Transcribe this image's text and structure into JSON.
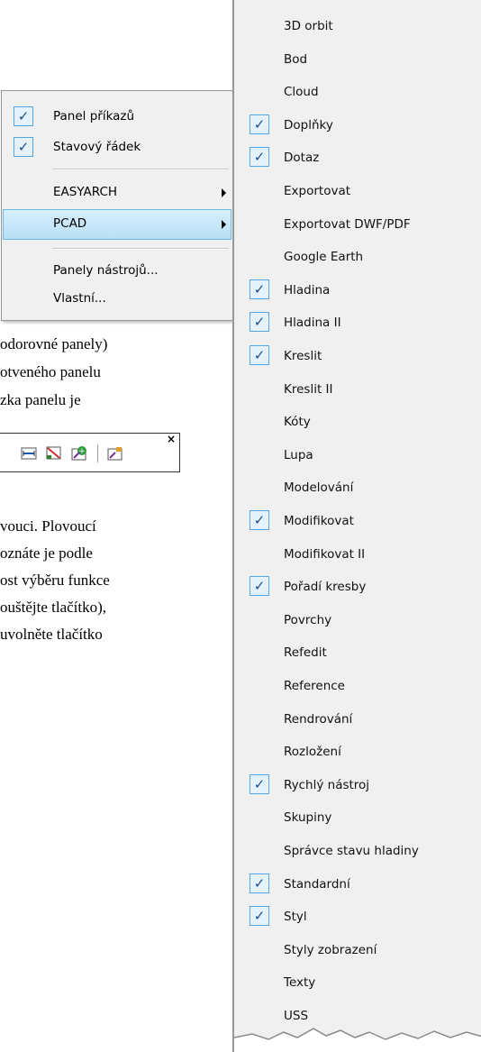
{
  "document": {
    "lines": [
      "odorovné panely)",
      "otveného panelu",
      "zka panelu je",
      "vouci. Plovoucí",
      "oznáte je podle",
      "ost výběru funkce",
      "ouštějte tlačítko),",
      "uvolněte tlačítko"
    ]
  },
  "context_menu": {
    "items": [
      {
        "label": "Panel příkazů",
        "checked": true
      },
      {
        "label": "Stavový řádek",
        "checked": true
      },
      {
        "label": "EASYARCH",
        "submenu": true
      },
      {
        "label": "PCAD",
        "submenu": true,
        "highlighted": true
      },
      {
        "label": "Panely nástrojů..."
      },
      {
        "label": "Vlastní..."
      }
    ]
  },
  "toolbar_menu": {
    "items": [
      {
        "label": "3D orbit",
        "checked": false
      },
      {
        "label": "Bod",
        "checked": false
      },
      {
        "label": "Cloud",
        "checked": false
      },
      {
        "label": "Doplňky",
        "checked": true
      },
      {
        "label": "Dotaz",
        "checked": true
      },
      {
        "label": "Exportovat",
        "checked": false
      },
      {
        "label": "Exportovat DWF/PDF",
        "checked": false
      },
      {
        "label": "Google Earth",
        "checked": false
      },
      {
        "label": "Hladina",
        "checked": true
      },
      {
        "label": "Hladina II",
        "checked": true
      },
      {
        "label": "Kreslit",
        "checked": true
      },
      {
        "label": "Kreslit II",
        "checked": false
      },
      {
        "label": "Kóty",
        "checked": false
      },
      {
        "label": "Lupa",
        "checked": false
      },
      {
        "label": "Modelování",
        "checked": false
      },
      {
        "label": "Modifikovat",
        "checked": true
      },
      {
        "label": "Modifikovat II",
        "checked": false
      },
      {
        "label": "Pořadí kresby",
        "checked": true
      },
      {
        "label": "Povrchy",
        "checked": false
      },
      {
        "label": "Refedit",
        "checked": false
      },
      {
        "label": "Reference",
        "checked": false
      },
      {
        "label": "Rendrování",
        "checked": false
      },
      {
        "label": "Rozložení",
        "checked": false
      },
      {
        "label": "Rychlý nástroj",
        "checked": true
      },
      {
        "label": "Skupiny",
        "checked": false
      },
      {
        "label": "Správce stavu hladiny",
        "checked": false
      },
      {
        "label": "Standardní",
        "checked": true
      },
      {
        "label": "Styl",
        "checked": true
      },
      {
        "label": "Styly zobrazení",
        "checked": false
      },
      {
        "label": "Texty",
        "checked": false
      },
      {
        "label": "USS",
        "checked": false
      }
    ]
  },
  "check_glyph": "✓",
  "colors": {
    "menu_bg": "#f0f0f0",
    "check_border": "#55a6e6",
    "highlight": "#cde8f7"
  }
}
